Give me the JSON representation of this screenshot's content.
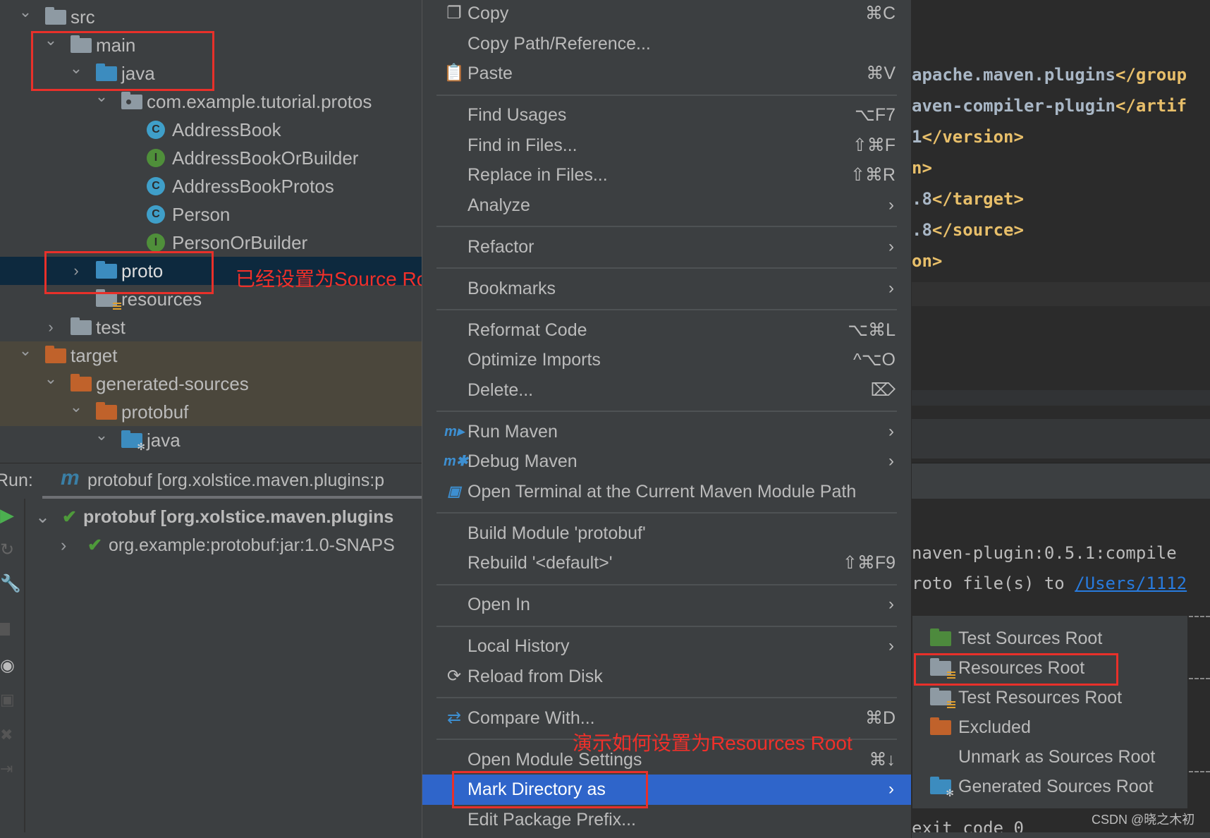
{
  "project_tree": {
    "rows": [
      {
        "label": "src",
        "level": 0,
        "chevron": "down",
        "icon": "folder",
        "color": "#8e9aa3"
      },
      {
        "label": "main",
        "level": 1,
        "chevron": "down",
        "icon": "folder",
        "color": "#8e9aa3"
      },
      {
        "label": "java",
        "level": 2,
        "chevron": "down",
        "icon": "folder",
        "color": "#3c8cbf"
      },
      {
        "label": "com.example.tutorial.protos",
        "level": 3,
        "chevron": "down",
        "icon": "package",
        "color": "#8e9aa3"
      },
      {
        "label": "AddressBook",
        "level": 4,
        "chevron": "",
        "icon": "class",
        "color": "#3f9fc9"
      },
      {
        "label": "AddressBookOrBuilder",
        "level": 4,
        "chevron": "",
        "icon": "interface",
        "color": "#4f8f3a"
      },
      {
        "label": "AddressBookProtos",
        "level": 4,
        "chevron": "",
        "icon": "class",
        "color": "#3f9fc9"
      },
      {
        "label": "Person",
        "level": 4,
        "chevron": "",
        "icon": "class",
        "color": "#3f9fc9"
      },
      {
        "label": "PersonOrBuilder",
        "level": 4,
        "chevron": "",
        "icon": "interface",
        "color": "#4f8f3a"
      },
      {
        "label": "proto",
        "level": 2,
        "chevron": "right",
        "icon": "folder",
        "color": "#3c8cbf",
        "selected": true
      },
      {
        "label": "resources",
        "level": 2,
        "chevron": "",
        "icon": "resources-folder",
        "color": "#8e9aa3"
      },
      {
        "label": "test",
        "level": 1,
        "chevron": "right",
        "icon": "folder",
        "color": "#8e9aa3"
      },
      {
        "label": "target",
        "level": 0,
        "chevron": "down",
        "icon": "folder",
        "color": "#c0622b",
        "excluded": true
      },
      {
        "label": "generated-sources",
        "level": 1,
        "chevron": "down",
        "icon": "folder",
        "color": "#c0622b",
        "excluded": true
      },
      {
        "label": "protobuf",
        "level": 2,
        "chevron": "down",
        "icon": "folder",
        "color": "#c0622b",
        "excluded": true
      },
      {
        "label": "java",
        "level": 3,
        "chevron": "down",
        "icon": "generated-folder",
        "color": "#3c8cbf"
      }
    ]
  },
  "annotations": {
    "source_root_note": "已经设置为Source Root",
    "resources_root_note": "演示如何设置为Resources Root"
  },
  "editor": {
    "lines": [
      {
        "text": "apache.maven.plugins",
        "tag": "</group"
      },
      {
        "text": "aven-compiler-plugin",
        "tag": "</artif"
      },
      {
        "text": "1",
        "tag": "</version>"
      },
      {
        "text": "",
        "tag": "n>"
      },
      {
        "text": ".8",
        "tag": "</target>"
      },
      {
        "text": ".8",
        "tag": "</source>"
      },
      {
        "text": "",
        "tag": "on>"
      }
    ]
  },
  "console": {
    "line1": "naven-plugin:0.5.1:compile",
    "line2_prefix": "roto file(s) to ",
    "line2_link": "/Users/1112",
    "line3": "  exit code 0"
  },
  "run_panel": {
    "label": "Run:",
    "tab_title": "protobuf [org.xolstice.maven.plugins:p",
    "tree": [
      {
        "label": "protobuf [org.xolstice.maven.plugins",
        "bold": true,
        "status": "success"
      },
      {
        "label": "org.example:protobuf:jar:1.0-SNAPS",
        "bold": false,
        "status": "success"
      }
    ]
  },
  "context_menu": {
    "items": [
      {
        "label": "Copy",
        "shortcut": "⌘C",
        "icon": "copy-icon",
        "glyph": "❐"
      },
      {
        "label": "Copy Path/Reference...",
        "shortcut": ""
      },
      {
        "label": "Paste",
        "shortcut": "⌘V",
        "icon": "paste-icon",
        "glyph": "📋"
      },
      {
        "sep": true
      },
      {
        "label": "Find Usages",
        "shortcut": "⌥F7"
      },
      {
        "label": "Find in Files...",
        "shortcut": "⇧⌘F"
      },
      {
        "label": "Replace in Files...",
        "shortcut": "⇧⌘R"
      },
      {
        "label": "Analyze",
        "submenu": true
      },
      {
        "sep": true
      },
      {
        "label": "Refactor",
        "submenu": true
      },
      {
        "sep": true
      },
      {
        "label": "Bookmarks",
        "submenu": true
      },
      {
        "sep": true
      },
      {
        "label": "Reformat Code",
        "shortcut": "⌥⌘L"
      },
      {
        "label": "Optimize Imports",
        "shortcut": "^⌥O"
      },
      {
        "label": "Delete...",
        "shortcut": "⌦"
      },
      {
        "sep": true
      },
      {
        "label": "Run Maven",
        "submenu": true,
        "icon": "run-maven-icon",
        "glyph": "m▸"
      },
      {
        "label": "Debug Maven",
        "submenu": true,
        "icon": "debug-maven-icon",
        "glyph": "m✱"
      },
      {
        "label": "Open Terminal at the Current Maven Module Path",
        "icon": "terminal-maven-icon",
        "glyph": "▣"
      },
      {
        "sep": true
      },
      {
        "label": "Build Module 'protobuf'"
      },
      {
        "label": "Rebuild '<default>'",
        "shortcut": "⇧⌘F9"
      },
      {
        "sep": true
      },
      {
        "label": "Open In",
        "submenu": true
      },
      {
        "sep": true
      },
      {
        "label": "Local History",
        "submenu": true
      },
      {
        "label": "Reload from Disk",
        "icon": "reload-icon",
        "glyph": "⟳"
      },
      {
        "sep": true
      },
      {
        "label": "Compare With...",
        "shortcut": "⌘D",
        "icon": "compare-icon",
        "glyph": "⇄"
      },
      {
        "sep": true
      },
      {
        "label": "Open Module Settings",
        "shortcut": "⌘↓"
      },
      {
        "label": "Mark Directory as",
        "submenu": true,
        "highlighted": true
      },
      {
        "label": "Edit Package Prefix..."
      }
    ]
  },
  "mark_submenu": {
    "items": [
      {
        "label": "Test Sources Root",
        "icon": "test-sources-folder",
        "color": "#4d8a3d"
      },
      {
        "label": "Resources Root",
        "icon": "resources-folder",
        "color": "#8e9aa3"
      },
      {
        "label": "Test Resources Root",
        "icon": "test-resources-folder",
        "color": "#8e9aa3"
      },
      {
        "label": "Excluded",
        "icon": "excluded-folder",
        "color": "#c0622b"
      },
      {
        "label": "Unmark as Sources Root",
        "icon": ""
      },
      {
        "label": "Generated Sources Root",
        "icon": "generated-folder",
        "color": "#3c8cbf"
      }
    ]
  },
  "watermark": "CSDN @晓之木初",
  "colors": {
    "accent": "#2f65ca",
    "annotation": "#e8302a",
    "selection": "#0d293e",
    "excluded_bg": "#4b473c"
  }
}
